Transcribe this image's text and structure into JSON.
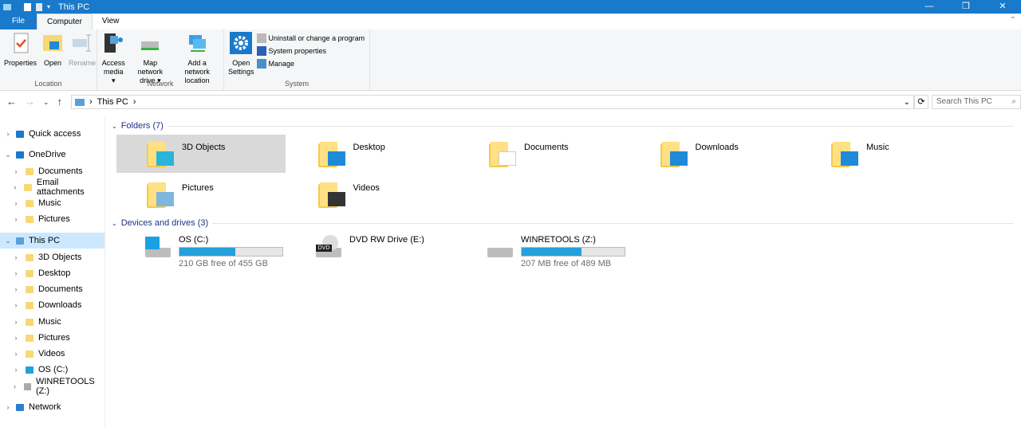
{
  "window": {
    "title": "This PC",
    "minimize": "—",
    "maximize": "❐",
    "close": "✕"
  },
  "ribbon_tabs": [
    {
      "label": "File"
    },
    {
      "label": "Computer"
    },
    {
      "label": "View"
    }
  ],
  "ribbon": {
    "location": {
      "label": "Location",
      "buttons": [
        "Properties",
        "Open",
        "Rename"
      ]
    },
    "network": {
      "label": "Network",
      "buttons": [
        {
          "l1": "Access",
          "l2": "media ▾"
        },
        {
          "l1": "Map network",
          "l2": "drive ▾"
        },
        {
          "l1": "Add a network",
          "l2": "location"
        }
      ]
    },
    "system": {
      "label": "System",
      "open_settings": {
        "l1": "Open",
        "l2": "Settings"
      },
      "small": [
        "Uninstall or change a program",
        "System properties",
        "Manage"
      ]
    }
  },
  "address": {
    "path": "This PC",
    "search_placeholder": "Search This PC"
  },
  "sidebar": {
    "items": [
      {
        "label": "Quick access",
        "level": 0,
        "expanded": false
      },
      {
        "label": "OneDrive",
        "level": 0,
        "expanded": true
      },
      {
        "label": "Documents",
        "level": 1
      },
      {
        "label": "Email attachments",
        "level": 1
      },
      {
        "label": "Music",
        "level": 1
      },
      {
        "label": "Pictures",
        "level": 1
      },
      {
        "label": "This PC",
        "level": 0,
        "expanded": true,
        "selected": true
      },
      {
        "label": "3D Objects",
        "level": 1
      },
      {
        "label": "Desktop",
        "level": 1
      },
      {
        "label": "Documents",
        "level": 1
      },
      {
        "label": "Downloads",
        "level": 1
      },
      {
        "label": "Music",
        "level": 1
      },
      {
        "label": "Pictures",
        "level": 1
      },
      {
        "label": "Videos",
        "level": 1
      },
      {
        "label": "OS (C:)",
        "level": 1
      },
      {
        "label": "WINRETOOLS (Z:)",
        "level": 1
      },
      {
        "label": "Network",
        "level": 0,
        "expanded": false
      }
    ]
  },
  "folders": {
    "header": "Folders (7)",
    "items": [
      "3D Objects",
      "Desktop",
      "Documents",
      "Downloads",
      "Music",
      "Pictures",
      "Videos"
    ]
  },
  "drives": {
    "header": "Devices and drives (3)",
    "items": [
      {
        "name": "OS (C:)",
        "free": "210 GB free of 455 GB",
        "used_fraction": 0.54
      },
      {
        "name": "DVD RW Drive (E:)"
      },
      {
        "name": "WINRETOOLS (Z:)",
        "free": "207 MB free of 489 MB",
        "used_fraction": 0.58
      }
    ]
  },
  "colors": {
    "accent": "#1979ca",
    "selection": "#cce8ff",
    "bar": "#26a0da"
  }
}
